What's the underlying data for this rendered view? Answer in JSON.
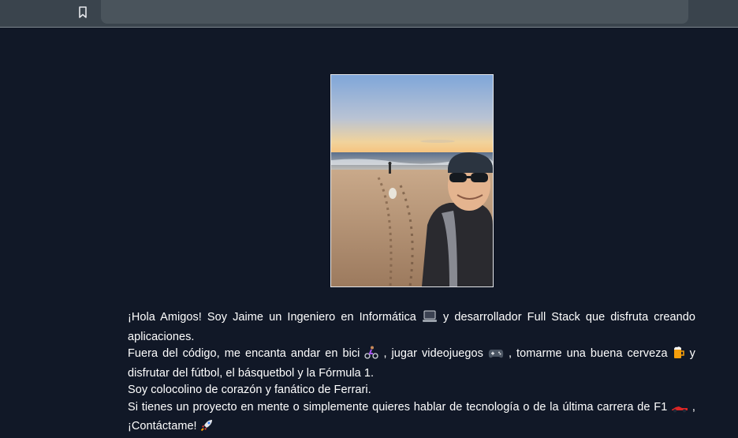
{
  "browser": {
    "bookmark_icon": "bookmark-icon",
    "address_bar_value": ""
  },
  "profile": {
    "photo_icon": "beach-selfie-photo"
  },
  "bio": {
    "l1a": "¡Hola Amigos! Soy Jaime un Ingeniero en Informática",
    "l1b": "y desarrollador Full Stack que disfruta creando aplicaciones.",
    "l2a": "Fuera del código, me encanta andar en bici",
    "l2b": ", jugar videojuegos",
    "l2c": ", tomarme una buena cerveza",
    "l2d": "y disfrutar del fútbol, el básquetbol y la Fórmula 1.",
    "l3": "Soy colocolino de corazón y fanático de Ferrari.",
    "l4a": "Si tienes un proyecto en mente o simplemente quieres hablar de tecnología o de la última carrera de F1",
    "l4b": ", ¡Contáctame!"
  },
  "colors": {
    "page_bg": "#111827",
    "toolbar_bg": "#3a444d",
    "text": "#ffffff"
  }
}
